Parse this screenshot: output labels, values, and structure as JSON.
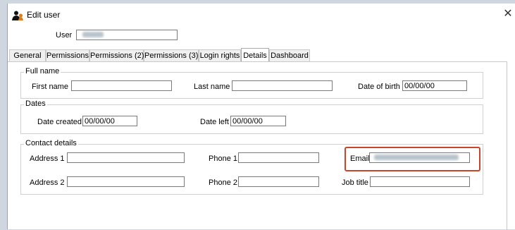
{
  "window": {
    "title": "Edit user",
    "close_symbol": "✕"
  },
  "user": {
    "label": "User",
    "value_redacted": true
  },
  "tabs": [
    {
      "label": "General",
      "active": false
    },
    {
      "label": "Permissions",
      "active": false
    },
    {
      "label": "Permissions (2)",
      "active": false
    },
    {
      "label": "Permissions (3)",
      "active": false
    },
    {
      "label": "Login rights",
      "active": false
    },
    {
      "label": "Details",
      "active": true
    },
    {
      "label": "Dashboard",
      "active": false
    }
  ],
  "full_name": {
    "legend": "Full name",
    "first_name_label": "First name",
    "first_name_value": "",
    "last_name_label": "Last name",
    "last_name_value": "",
    "dob_label": "Date of birth",
    "dob_value": "00/00/00"
  },
  "dates": {
    "legend": "Dates",
    "created_label": "Date created",
    "created_value": "00/00/00",
    "left_label": "Date left",
    "left_value": "00/00/00"
  },
  "contact": {
    "legend": "Contact details",
    "address1_label": "Address 1",
    "address1_value": "",
    "address2_label": "Address 2",
    "address2_value": "",
    "phone1_label": "Phone 1",
    "phone1_value": "",
    "phone2_label": "Phone 2",
    "phone2_value": "",
    "email_label": "Email",
    "email_value_redacted": true,
    "jobtitle_label": "Job title",
    "jobtitle_value": ""
  },
  "colors": {
    "highlight": "#c9452a",
    "background": "#cfd6e0"
  },
  "icons": {
    "app": "user-icon",
    "close": "close-icon"
  }
}
